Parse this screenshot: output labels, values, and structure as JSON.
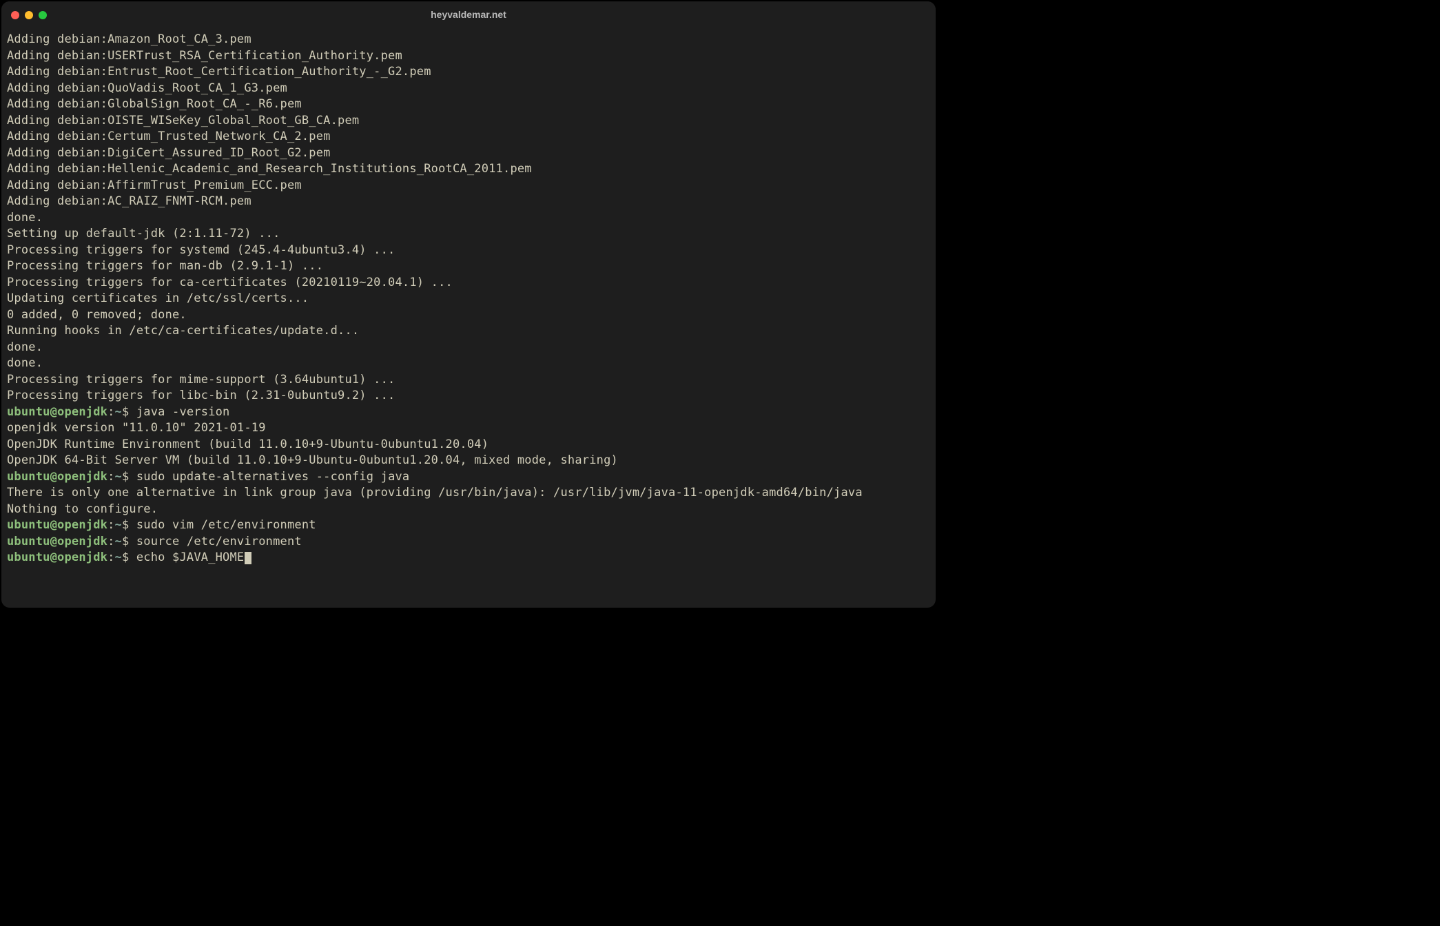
{
  "window": {
    "title": "heyvaldemar.net"
  },
  "prompt": {
    "user": "ubuntu",
    "host": "openjdk",
    "path": "~",
    "sep1": "@",
    "sep2": ":",
    "symbol": "$"
  },
  "output_lines": [
    "Adding debian:Amazon_Root_CA_3.pem",
    "Adding debian:USERTrust_RSA_Certification_Authority.pem",
    "Adding debian:Entrust_Root_Certification_Authority_-_G2.pem",
    "Adding debian:QuoVadis_Root_CA_1_G3.pem",
    "Adding debian:GlobalSign_Root_CA_-_R6.pem",
    "Adding debian:OISTE_WISeKey_Global_Root_GB_CA.pem",
    "Adding debian:Certum_Trusted_Network_CA_2.pem",
    "Adding debian:DigiCert_Assured_ID_Root_G2.pem",
    "Adding debian:Hellenic_Academic_and_Research_Institutions_RootCA_2011.pem",
    "Adding debian:AffirmTrust_Premium_ECC.pem",
    "Adding debian:AC_RAIZ_FNMT-RCM.pem",
    "done.",
    "Setting up default-jdk (2:1.11-72) ...",
    "Processing triggers for systemd (245.4-4ubuntu3.4) ...",
    "Processing triggers for man-db (2.9.1-1) ...",
    "Processing triggers for ca-certificates (20210119~20.04.1) ...",
    "Updating certificates in /etc/ssl/certs...",
    "0 added, 0 removed; done.",
    "Running hooks in /etc/ca-certificates/update.d...",
    "",
    "done.",
    "done.",
    "Processing triggers for mime-support (3.64ubuntu1) ...",
    "Processing triggers for libc-bin (2.31-0ubuntu9.2) ..."
  ],
  "commands": [
    {
      "cmd": "java -version",
      "out": [
        "openjdk version \"11.0.10\" 2021-01-19",
        "OpenJDK Runtime Environment (build 11.0.10+9-Ubuntu-0ubuntu1.20.04)",
        "OpenJDK 64-Bit Server VM (build 11.0.10+9-Ubuntu-0ubuntu1.20.04, mixed mode, sharing)"
      ]
    },
    {
      "cmd": "sudo update-alternatives --config java",
      "out": [
        "There is only one alternative in link group java (providing /usr/bin/java): /usr/lib/jvm/java-11-openjdk-amd64/bin/java",
        "Nothing to configure."
      ]
    },
    {
      "cmd": "sudo vim /etc/environment",
      "out": []
    },
    {
      "cmd": "source /etc/environment",
      "out": []
    },
    {
      "cmd": "echo $JAVA_HOME",
      "out": [],
      "cursor": true
    }
  ]
}
